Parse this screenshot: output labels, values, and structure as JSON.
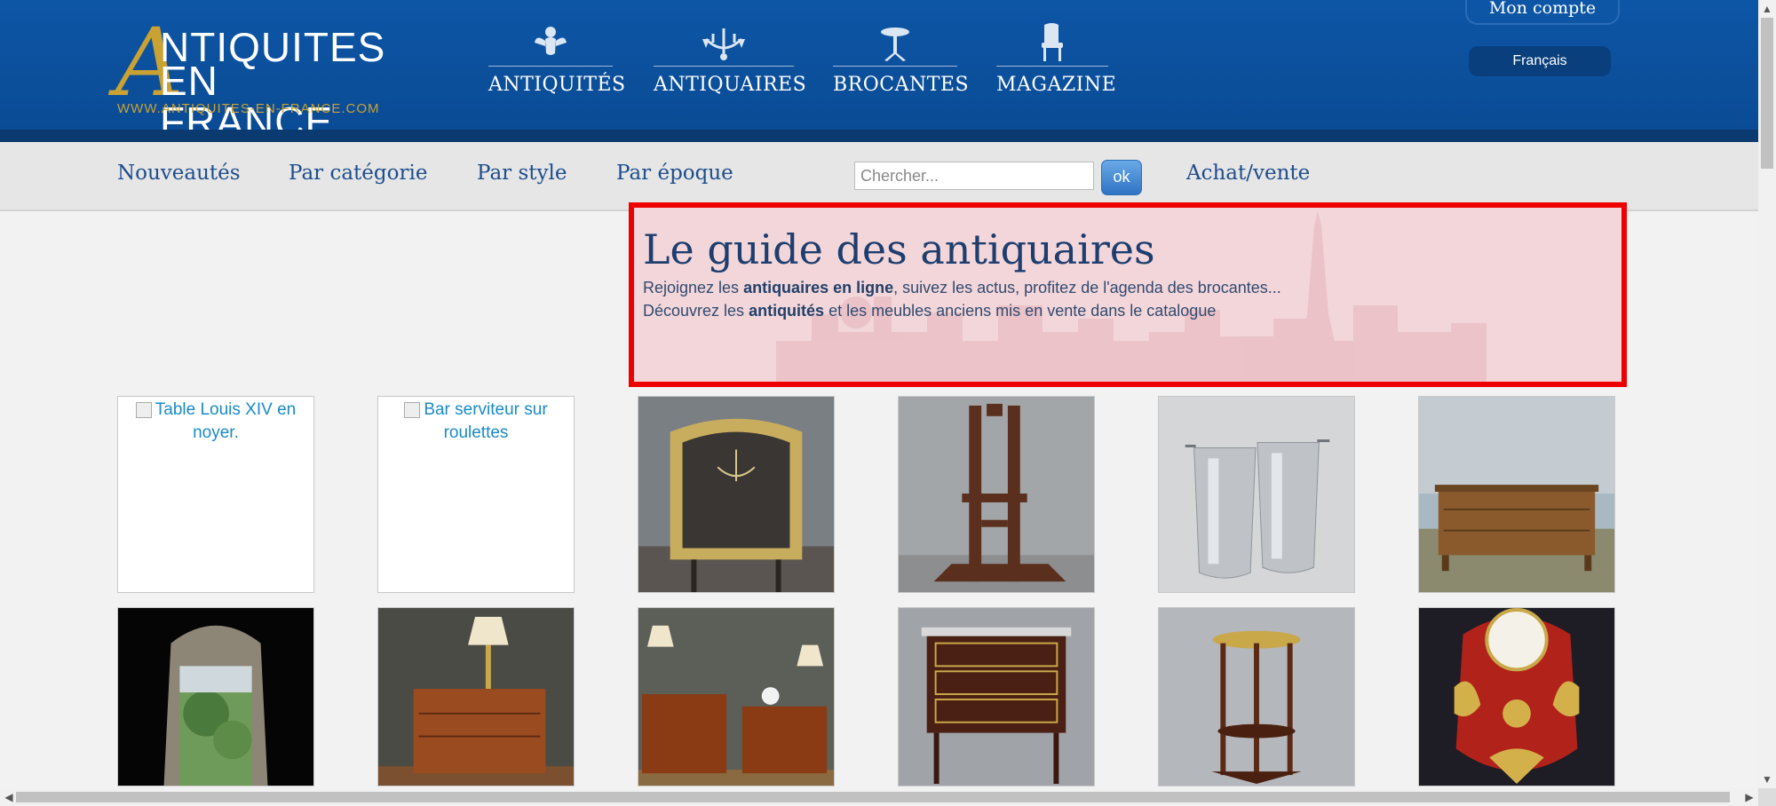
{
  "header": {
    "logo": {
      "big_letter": "A",
      "line1": "NTIQUITES",
      "line2": "EN FRANCE",
      "url": "WWW.ANTIQUITES-EN-FRANCE.COM"
    },
    "main_nav": [
      {
        "label": "ANTIQUITÉS",
        "icon": "cherub-icon"
      },
      {
        "label": "ANTIQUAIRES",
        "icon": "chandelier-icon"
      },
      {
        "label": "BROCANTES",
        "icon": "gueridon-table-icon"
      },
      {
        "label": "MAGAZINE",
        "icon": "chair-icon"
      }
    ],
    "account_label": "Mon compte",
    "language_label": "Français"
  },
  "subnav": {
    "links": [
      "Nouveautés",
      "Par catégorie",
      "Par style",
      "Par époque"
    ],
    "search_placeholder": "Chercher...",
    "search_button": "ok",
    "buy_sell": "Achat/vente"
  },
  "hero": {
    "title": "Le guide des antiquaires",
    "line1": {
      "pre": "Rejoignez les ",
      "bold": "antiquaires en ligne",
      "post": ", suivez les actus, profitez de l'agenda des brocantes..."
    },
    "line2": {
      "pre": "Découvrez les ",
      "bold": "antiquités",
      "post": " et les meubles anciens mis en vente dans le catalogue"
    }
  },
  "products": [
    {
      "alt": "Table Louis XIV en noyer.",
      "broken": true
    },
    {
      "alt": "Bar serviteur sur roulettes",
      "broken": true
    },
    {
      "image": "gilt-mirror",
      "broken": false
    },
    {
      "image": "wooden-easel",
      "broken": false
    },
    {
      "image": "silver-wine-coolers",
      "broken": false
    },
    {
      "image": "chest-of-drawers",
      "broken": false
    },
    {
      "image": "carved-mirror",
      "broken": false
    },
    {
      "image": "side-table-lamp",
      "broken": false
    },
    {
      "image": "pair-side-tables",
      "broken": false
    },
    {
      "image": "mahogany-chiffonnier",
      "broken": false
    },
    {
      "image": "tripod-gueridon",
      "broken": false
    },
    {
      "image": "boulle-cartel-clock",
      "broken": false
    }
  ],
  "colors": {
    "header_blue": "#0d56a6",
    "gold": "#c9a233",
    "nav_text": "#1d4d8c",
    "highlight_border": "#ee0000"
  }
}
